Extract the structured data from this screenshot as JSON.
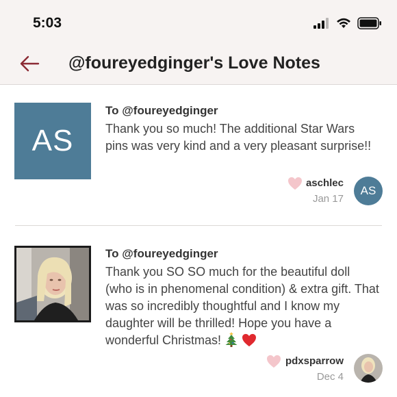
{
  "status_bar": {
    "time": "5:03"
  },
  "nav": {
    "title": "@foureyedginger's Love Notes"
  },
  "notes": [
    {
      "thumb_initials": "AS",
      "to": "To @foureyedginger",
      "message": "Thank you so much! The additional Star Wars pins was very kind and a very pleasant surprise!!",
      "sender": "aschlec",
      "date": "Jan 17",
      "avatar_initials": "AS"
    },
    {
      "to": "To @foureyedginger",
      "message": "Thank you SO SO much for the beautiful doll (who is in phenomenal condition) & extra gift. That was so incredibly thoughtful and I know my daughter will be thrilled! Hope you have a wonderful Christmas!",
      "sender": "pdxsparrow",
      "date": "Dec 4"
    }
  ],
  "colors": {
    "accent": "#8b2a34",
    "heart": "#f4c6cb",
    "avatar_bg": "#4e7c97",
    "header_bg": "#f7f3f2"
  },
  "icons": [
    "back-arrow-icon",
    "signal-icon",
    "wifi-icon",
    "battery-icon",
    "heart-icon",
    "christmas-tree-emoji",
    "red-heart-emoji"
  ]
}
